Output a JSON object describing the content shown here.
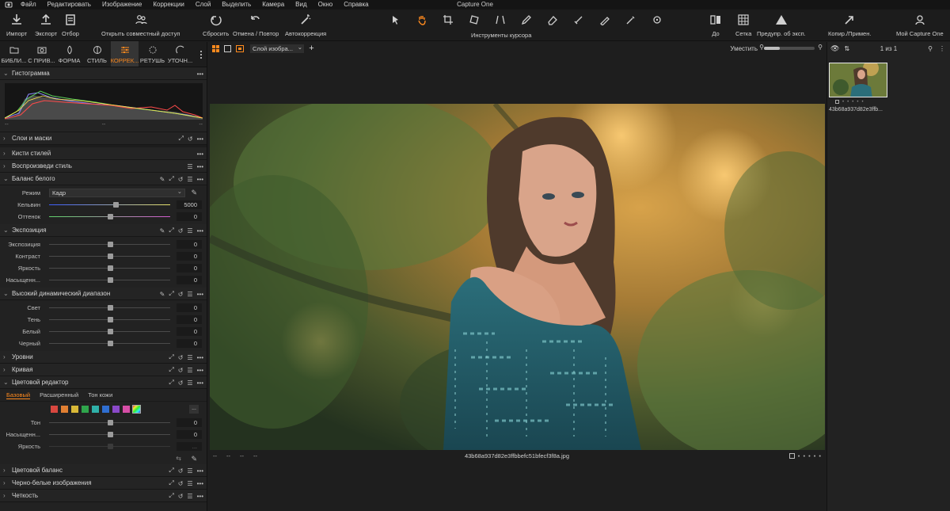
{
  "app": {
    "title": "Capture One"
  },
  "menu": [
    "Файл",
    "Редактировать",
    "Изображение",
    "Коррекции",
    "Слой",
    "Выделить",
    "Камера",
    "Вид",
    "Окно",
    "Справка"
  ],
  "toolbar": {
    "import": "Импорт",
    "export": "Экспорт",
    "select": "Отбор",
    "share": "Открыть совместный доступ",
    "reset": "Сбросить",
    "undo_redo": "Отмена / Повтор",
    "autocorrect": "Автокоррекция",
    "cursor_tools": "Инструменты курсора",
    "before": "До",
    "grid": "Сетка",
    "exposure_warning": "Предупр. об эксп.",
    "copy_apply": "Копир./Примен.",
    "my_capture_one": "Мой Capture One"
  },
  "tool_tabs": [
    {
      "label": "БИБЛИ...",
      "icon": "folder-icon"
    },
    {
      "label": "С ПРИВ...",
      "icon": "camera-icon"
    },
    {
      "label": "ФОРМА",
      "icon": "lens-icon"
    },
    {
      "label": "СТИЛЬ",
      "icon": "palette-icon"
    },
    {
      "label": "КОРРЕК...",
      "icon": "sliders-icon",
      "active": true
    },
    {
      "label": "РЕТУШЬ",
      "icon": "retouch-icon"
    },
    {
      "label": "УТОЧН...",
      "icon": "refine-icon"
    }
  ],
  "panels": {
    "histogram": {
      "title": "Гистограмма",
      "labels": [
        "--",
        "--",
        "--"
      ]
    },
    "layers": {
      "title": "Слои и маски"
    },
    "style_brushes": {
      "title": "Кисти стилей"
    },
    "replay_style": {
      "title": "Воспроизведи стиль"
    },
    "white_balance": {
      "title": "Баланс белого",
      "mode_label": "Режим",
      "mode_value": "Кадр",
      "kelvin_label": "Кельвин",
      "kelvin_value": "5000",
      "kelvin_level": 0.55,
      "tint_label": "Оттенок",
      "tint_value": "0",
      "tint_level": 0.5
    },
    "exposure": {
      "title": "Экспозиция",
      "rows": [
        {
          "label": "Экспозиция",
          "value": "0",
          "level": 0.5
        },
        {
          "label": "Контраст",
          "value": "0",
          "level": 0.5
        },
        {
          "label": "Яркость",
          "value": "0",
          "level": 0.5
        },
        {
          "label": "Насыщенн...",
          "value": "0",
          "level": 0.5
        }
      ]
    },
    "hdr": {
      "title": "Высокий динамический диапазон",
      "rows": [
        {
          "label": "Свет",
          "value": "0",
          "level": 0.5
        },
        {
          "label": "Тень",
          "value": "0",
          "level": 0.5
        },
        {
          "label": "Белый",
          "value": "0",
          "level": 0.5
        },
        {
          "label": "Черный",
          "value": "0",
          "level": 0.5
        }
      ]
    },
    "levels": {
      "title": "Уровни"
    },
    "curve": {
      "title": "Кривая"
    },
    "color_editor": {
      "title": "Цветовой редактор",
      "tabs": [
        "Базовый",
        "Расширенный",
        "Тон кожи"
      ],
      "more_label": "...",
      "swatches": [
        "#d8473f",
        "#e07f32",
        "#d8b837",
        "#2fa54c",
        "#2fb0a8",
        "#2f6ed0",
        "#8a49c8",
        "#d64ea6"
      ],
      "rows": [
        {
          "label": "Тон",
          "value": "0",
          "level": 0.5
        },
        {
          "label": "Насыщенн...",
          "value": "0",
          "level": 0.5
        },
        {
          "label": "Яркость",
          "value": "...",
          "level": 0.5
        }
      ]
    },
    "color_balance": {
      "title": "Цветовой баланс"
    },
    "bw": {
      "title": "Черно-белые изображения"
    },
    "clarity": {
      "title": "Четкость"
    }
  },
  "viewer": {
    "layer_select": "Слой изобра...",
    "fit_label": "Уместить",
    "zoom_level": 0.3,
    "filename": "43b68a937d82e3ffbbefc51bfecf3f8a.jpg",
    "footer_dashes": [
      "--",
      "--",
      "--",
      "--"
    ]
  },
  "browser": {
    "count": "1 из 1",
    "thumb_name": "43b68a937d82e3ffb..."
  },
  "colors": {
    "accent": "#ff8a1e",
    "panel_bg": "#222222",
    "viewer_bg": "#1e1e1e"
  }
}
